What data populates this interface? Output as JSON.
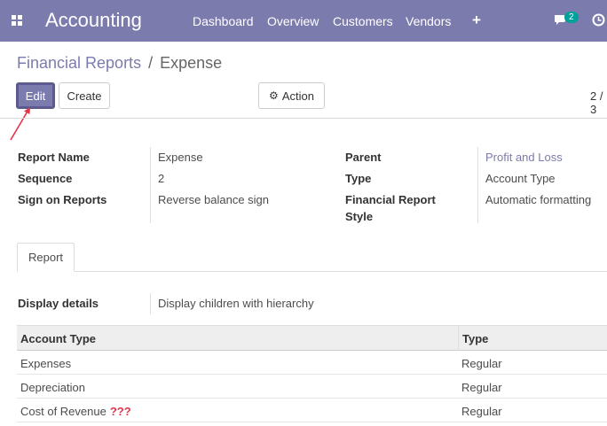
{
  "navbar": {
    "app_title": "Accounting",
    "menu": [
      "Dashboard",
      "Overview",
      "Customers",
      "Vendors"
    ],
    "add_icon": "plus-icon",
    "apps_icon": "apps-grid-icon",
    "chat_icon": "chat-icon",
    "chat_badge": "2",
    "clock_icon": "clock-icon",
    "bg_color": "#7c7bad"
  },
  "breadcrumb": {
    "parent": "Financial Reports",
    "separator": "/",
    "current": "Expense"
  },
  "buttons": {
    "edit": "Edit",
    "create": "Create",
    "action": "Action",
    "action_icon": "gear-icon"
  },
  "pager": "2 / 3",
  "annotation_arrow_color": "#e8334a",
  "form": {
    "report_name_label": "Report Name",
    "report_name": "Expense",
    "sequence_label": "Sequence",
    "sequence": "2",
    "sign_label": "Sign on Reports",
    "sign": "Reverse balance sign",
    "parent_label": "Parent",
    "parent": "Profit and Loss",
    "type_label": "Type",
    "type": "Account Type",
    "style_label_1": "Financial Report",
    "style_label_2": "Style",
    "style": "Automatic formatting"
  },
  "notebook": {
    "tab": "Report",
    "display_details_label": "Display details",
    "display_details": "Display children with hierarchy"
  },
  "table": {
    "columns": [
      "Account Type",
      "Type"
    ],
    "rows": [
      {
        "account_type": "Expenses",
        "type": "Regular",
        "note": ""
      },
      {
        "account_type": "Depreciation",
        "type": "Regular",
        "note": ""
      },
      {
        "account_type": "Cost of Revenue",
        "type": "Regular",
        "note": "???"
      }
    ]
  }
}
